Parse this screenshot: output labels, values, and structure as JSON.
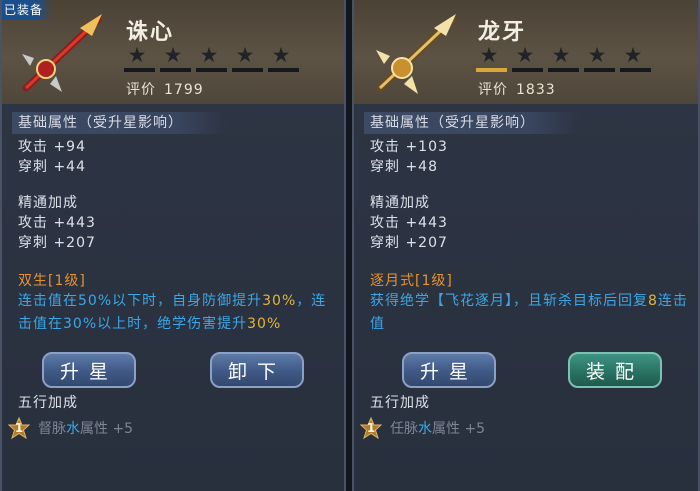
{
  "left": {
    "equipped_tag": "已装备",
    "name": "诛心",
    "stars_total": 5,
    "stars_filled": 0,
    "rating_label": "评价",
    "rating_value": "1799",
    "base_title": "基础属性（受升星影响）",
    "base_stats": [
      "攻击 +94",
      "穿刺 +44"
    ],
    "mastery_title": "精通加成",
    "mastery_stats": [
      "攻击 +443",
      "穿刺 +207"
    ],
    "skill_name": "双生[1级]",
    "skill_desc_parts": [
      {
        "text": "连击值在50%以下时，自身防御提升",
        "hl": false
      },
      {
        "text": "30%",
        "hl": true
      },
      {
        "text": "，连击值在30%以上时，绝学伤害提升",
        "hl": false
      },
      {
        "text": "30%",
        "hl": true
      }
    ],
    "wuxing_title": "五行加成",
    "wuxing_badge": "1",
    "wuxing_pre": "督脉",
    "wuxing_element": "水",
    "wuxing_post": "属性 +5",
    "btn1": "升星",
    "btn2": "卸下"
  },
  "right": {
    "name": "龙牙",
    "stars_total": 5,
    "stars_filled": 0,
    "rating_label": "评价",
    "rating_value": "1833",
    "base_title": "基础属性（受升星影响）",
    "base_stats": [
      "攻击 +103",
      "穿刺 +48"
    ],
    "mastery_title": "精通加成",
    "mastery_stats": [
      "攻击 +443",
      "穿刺 +207"
    ],
    "skill_name": "逐月式[1级]",
    "skill_desc_parts": [
      {
        "text": "获得绝学【飞花逐月】，且斩杀目标后回复",
        "hl": false
      },
      {
        "text": "8",
        "hl": true
      },
      {
        "text": "连击值",
        "hl": false
      }
    ],
    "wuxing_title": "五行加成",
    "wuxing_badge": "1",
    "wuxing_pre": "任脉",
    "wuxing_element": "水",
    "wuxing_post": "属性 +5",
    "btn1": "升星",
    "btn2": "装配"
  },
  "colors": {
    "accent_orange": "#e7922d",
    "skill_blue": "#3aa8e8",
    "highlight": "#e3b53c",
    "star_bar_gold": "#d8a838"
  }
}
